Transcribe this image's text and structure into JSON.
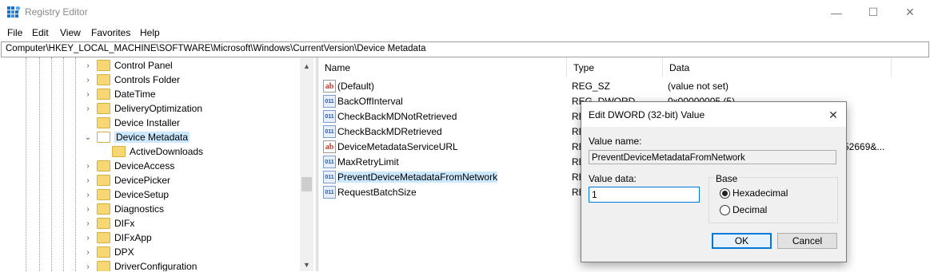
{
  "window": {
    "title": "Registry Editor",
    "minimize": "—",
    "maximize": "☐",
    "close": "✕"
  },
  "menu": [
    "File",
    "Edit",
    "View",
    "Favorites",
    "Help"
  ],
  "address": "Computer\\HKEY_LOCAL_MACHINE\\SOFTWARE\\Microsoft\\Windows\\CurrentVersion\\Device Metadata",
  "tree": {
    "items": [
      {
        "label": "Control Panel",
        "chev": "›"
      },
      {
        "label": "Controls Folder",
        "chev": "›"
      },
      {
        "label": "DateTime",
        "chev": "›"
      },
      {
        "label": "DeliveryOptimization",
        "chev": "›"
      },
      {
        "label": "Device Installer",
        "chev": ""
      },
      {
        "label": "Device Metadata",
        "chev": "⌄",
        "selected": true
      },
      {
        "label": "ActiveDownloads",
        "chev": "",
        "child": true
      },
      {
        "label": "DeviceAccess",
        "chev": "›"
      },
      {
        "label": "DevicePicker",
        "chev": "›"
      },
      {
        "label": "DeviceSetup",
        "chev": "›"
      },
      {
        "label": "Diagnostics",
        "chev": "›"
      },
      {
        "label": "DIFx",
        "chev": "›"
      },
      {
        "label": "DIFxApp",
        "chev": "›"
      },
      {
        "label": "DPX",
        "chev": "›"
      },
      {
        "label": "DriverConfiguration",
        "chev": "›"
      }
    ],
    "scroll_up": "▲",
    "scroll_down": "▼"
  },
  "list": {
    "columns": [
      "Name",
      "Type",
      "Data"
    ],
    "rows": [
      {
        "icon": "ab",
        "name": "(Default)",
        "type": "REG_SZ",
        "data": "(value not set)"
      },
      {
        "icon": "011",
        "name": "BackOffInterval",
        "type": "REG_DWORD",
        "data": "0x00000005 (5)"
      },
      {
        "icon": "011",
        "name": "CheckBackMDNotRetrieved",
        "type": "RE",
        "data": ""
      },
      {
        "icon": "011",
        "name": "CheckBackMDRetrieved",
        "type": "RE",
        "data": ""
      },
      {
        "icon": "ab",
        "name": "DeviceMetadataServiceURL",
        "type": "RE",
        "data": "52669&..."
      },
      {
        "icon": "011",
        "name": "MaxRetryLimit",
        "type": "RE",
        "data": ""
      },
      {
        "icon": "011",
        "name": "PreventDeviceMetadataFromNetwork",
        "type": "RE",
        "data": "",
        "selected": true
      },
      {
        "icon": "011",
        "name": "RequestBatchSize",
        "type": "RE",
        "data": ""
      }
    ]
  },
  "dialog": {
    "title": "Edit DWORD (32-bit) Value",
    "close": "✕",
    "value_name_label": "Value name:",
    "value_name": "PreventDeviceMetadataFromNetwork",
    "value_data_label": "Value data:",
    "value_data": "1",
    "base_label": "Base",
    "base_options": [
      "Hexadecimal",
      "Decimal"
    ],
    "base_selected": "Hexadecimal",
    "ok": "OK",
    "cancel": "Cancel"
  },
  "colors": {
    "selection": "#cce8ff",
    "accent": "#0078d7",
    "folder": "#f7d774"
  }
}
